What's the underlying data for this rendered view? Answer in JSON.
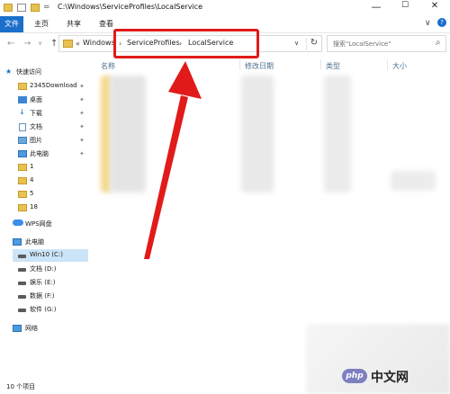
{
  "window": {
    "title": "C:\\Windows\\ServiceProfiles\\LocalService",
    "quick_access_separator": "=",
    "minimize": "—",
    "maximize": "☐",
    "close": "✕"
  },
  "ribbon": {
    "tabs": [
      "文件",
      "主页",
      "共享",
      "查看"
    ],
    "expand": "∨",
    "help": "?"
  },
  "nav": {
    "back": "←",
    "forward": "→",
    "recent": "∨",
    "up": "↑",
    "refresh": "↻"
  },
  "address": {
    "sep0": "«",
    "crumbs": [
      "Windows",
      "ServiceProfiles",
      "LocalService"
    ],
    "sep": "›",
    "dropdown": "∨"
  },
  "search": {
    "placeholder": "搜索\"LocalService\"",
    "icon": "⌕"
  },
  "columns": [
    "名称",
    "修改日期",
    "类型",
    "大小"
  ],
  "sidebar": {
    "quick_access": "快速访问",
    "items": [
      {
        "label": "2345Download",
        "pinned": true
      },
      {
        "label": "桌面",
        "pinned": true
      },
      {
        "label": "下载",
        "pinned": true
      },
      {
        "label": "文档",
        "pinned": true
      },
      {
        "label": "图片",
        "pinned": true
      },
      {
        "label": "此电脑",
        "pinned": true
      },
      {
        "label": "1",
        "pinned": false
      },
      {
        "label": "4",
        "pinned": false
      },
      {
        "label": "5",
        "pinned": false
      },
      {
        "label": "18",
        "pinned": false
      }
    ],
    "pin_glyph": "✦",
    "wps": "WPS网盘",
    "this_pc": "此电脑",
    "drives": [
      "Win10 (C:)",
      "文档 (D:)",
      "娱乐 (E:)",
      "数据 (F:)",
      "软件 (G:)"
    ],
    "network": "网络"
  },
  "status": {
    "count": "10 个项目",
    "view_toggle": "☰ ▦"
  },
  "watermark": {
    "logo": "php",
    "text": "中文网"
  },
  "colors": {
    "accent": "#1a6fcb",
    "annotation": "#e11a1a",
    "folder": "#e8c153",
    "selected": "#cce4f7"
  }
}
